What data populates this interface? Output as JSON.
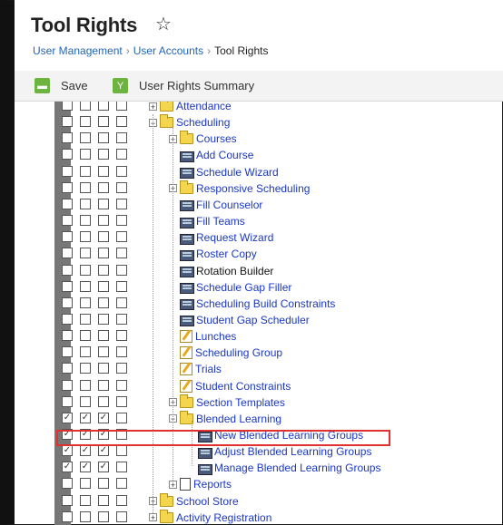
{
  "header": {
    "title": "Tool Rights"
  },
  "breadcrumb": [
    {
      "label": "User Management",
      "link": true
    },
    {
      "label": "User Accounts",
      "link": true
    },
    {
      "label": "Tool Rights",
      "link": false
    }
  ],
  "toolbar": {
    "save_label": "Save",
    "summary_label": "User Rights Summary"
  },
  "tree": [
    {
      "label": "Attendance",
      "indent": 0,
      "kind": "folder",
      "expander": "+",
      "checks": [
        false,
        false,
        false,
        false
      ]
    },
    {
      "label": "Scheduling",
      "indent": 0,
      "kind": "folder",
      "expander": "-",
      "checks": [
        false,
        false,
        false,
        false
      ]
    },
    {
      "label": "Courses",
      "indent": 1,
      "kind": "folder",
      "expander": "+",
      "checks": [
        false,
        false,
        false,
        false
      ]
    },
    {
      "label": "Add Course",
      "indent": 1,
      "kind": "tool",
      "checks": [
        false,
        false,
        false,
        false
      ]
    },
    {
      "label": "Schedule Wizard",
      "indent": 1,
      "kind": "tool",
      "checks": [
        false,
        false,
        false,
        false
      ]
    },
    {
      "label": "Responsive Scheduling",
      "indent": 1,
      "kind": "folder",
      "expander": "+",
      "checks": [
        false,
        false,
        false,
        false
      ]
    },
    {
      "label": "Fill Counselor",
      "indent": 1,
      "kind": "tool",
      "checks": [
        false,
        false,
        false,
        false
      ]
    },
    {
      "label": "Fill Teams",
      "indent": 1,
      "kind": "tool",
      "checks": [
        false,
        false,
        false,
        false
      ]
    },
    {
      "label": "Request Wizard",
      "indent": 1,
      "kind": "tool",
      "checks": [
        false,
        false,
        false,
        false
      ]
    },
    {
      "label": "Roster Copy",
      "indent": 1,
      "kind": "tool",
      "checks": [
        false,
        false,
        false,
        false
      ]
    },
    {
      "label": "Rotation Builder",
      "indent": 1,
      "kind": "tool",
      "plain": true,
      "checks": [
        false,
        false,
        false,
        false
      ]
    },
    {
      "label": "Schedule Gap Filler",
      "indent": 1,
      "kind": "tool",
      "checks": [
        false,
        false,
        false,
        false
      ]
    },
    {
      "label": "Scheduling Build Constraints",
      "indent": 1,
      "kind": "tool",
      "checks": [
        false,
        false,
        false,
        false
      ]
    },
    {
      "label": "Student Gap Scheduler",
      "indent": 1,
      "kind": "tool",
      "checks": [
        false,
        false,
        false,
        false
      ]
    },
    {
      "label": "Lunches",
      "indent": 1,
      "kind": "edit",
      "checks": [
        false,
        false,
        false,
        false
      ]
    },
    {
      "label": "Scheduling Group",
      "indent": 1,
      "kind": "edit",
      "checks": [
        false,
        false,
        false,
        false
      ]
    },
    {
      "label": "Trials",
      "indent": 1,
      "kind": "edit",
      "checks": [
        false,
        false,
        false,
        false
      ]
    },
    {
      "label": "Student Constraints",
      "indent": 1,
      "kind": "edit",
      "checks": [
        false,
        false,
        false,
        false
      ]
    },
    {
      "label": "Section Templates",
      "indent": 1,
      "kind": "folder",
      "expander": "+",
      "checks": [
        false,
        false,
        false,
        false
      ]
    },
    {
      "label": "Blended Learning",
      "indent": 1,
      "kind": "folder",
      "expander": "-",
      "checks": [
        true,
        true,
        true,
        false
      ]
    },
    {
      "label": "New Blended Learning Groups",
      "indent": 2,
      "kind": "tool",
      "checks": [
        true,
        true,
        true,
        false
      ]
    },
    {
      "label": "Adjust Blended Learning Groups",
      "indent": 2,
      "kind": "tool",
      "checks": [
        true,
        true,
        true,
        false
      ]
    },
    {
      "label": "Manage Blended Learning Groups",
      "indent": 2,
      "kind": "tool",
      "checks": [
        true,
        true,
        true,
        false
      ]
    },
    {
      "label": "Reports",
      "indent": 1,
      "kind": "page",
      "expander": "+",
      "checks": [
        false,
        false,
        false,
        false
      ]
    },
    {
      "label": "School Store",
      "indent": 0,
      "kind": "folder",
      "expander": "+",
      "checks": [
        false,
        false,
        false,
        false
      ]
    },
    {
      "label": "Activity Registration",
      "indent": 0,
      "kind": "folder",
      "expander": "+",
      "checks": [
        false,
        false,
        false,
        false
      ]
    }
  ]
}
